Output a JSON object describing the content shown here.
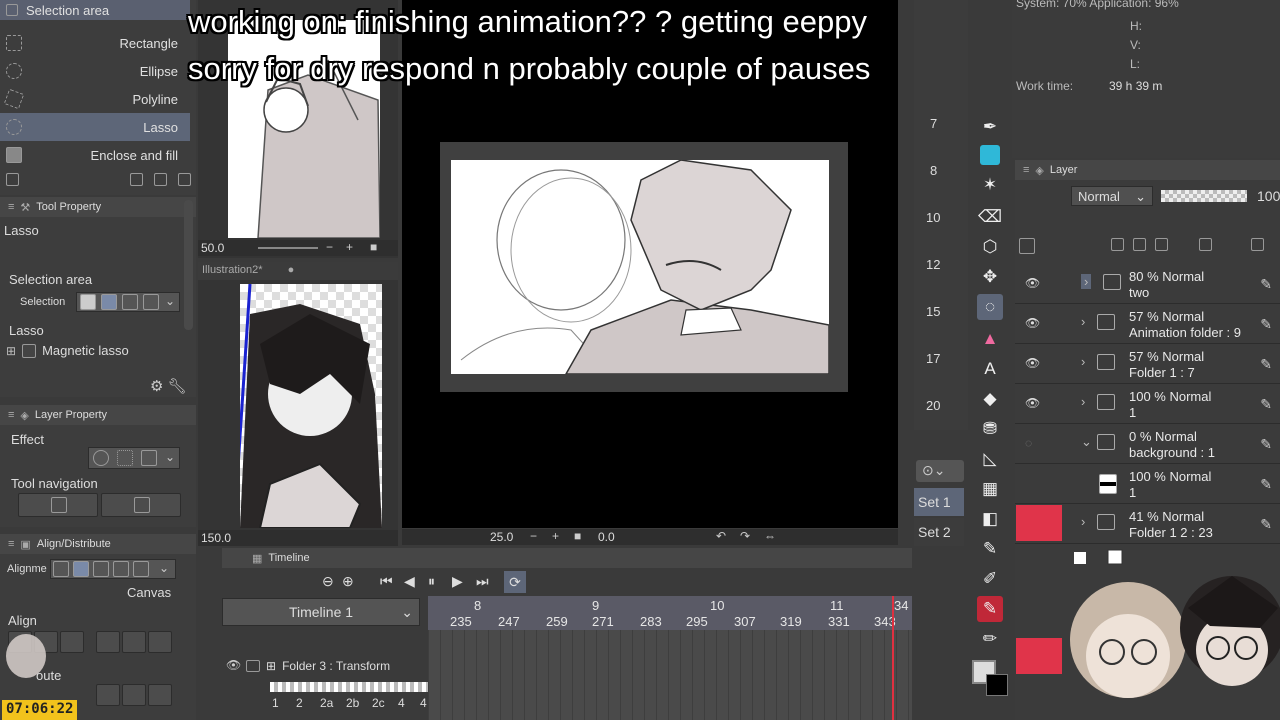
{
  "caption": {
    "line1": "working on: finishing animation?? ? getting eeppy",
    "line2": "sorry for dry respond n probably couple of pauses"
  },
  "tools": {
    "header": "Selection area",
    "items": [
      "Rectangle",
      "Ellipse",
      "Polyline",
      "Lasso",
      "Enclose and fill"
    ],
    "selected": "Lasso"
  },
  "tool_property": {
    "header": "Tool Property",
    "tool_name": "Lasso",
    "selection_area_label": "Selection area",
    "selection_label": "Selection",
    "lasso_label": "Lasso",
    "magnetic_label": "Magnetic lasso"
  },
  "layer_property": {
    "header": "Layer Property",
    "effect_label": "Effect",
    "tool_nav_label": "Tool navigation"
  },
  "align": {
    "header": "Align/Distribute",
    "alignment_label": "Alignme",
    "canvas_label": "Canvas",
    "align_label": "Align",
    "distribute_label": "oute"
  },
  "clock": "07:06:22",
  "preview1": {
    "zoom": "50.0"
  },
  "preview2": {
    "tab": "Illustration2*",
    "zoom": "150.0"
  },
  "canvas_bar": {
    "zoom": "25.0",
    "angle": "0.0"
  },
  "timeline": {
    "header": "Timeline",
    "name": "Timeline 1",
    "folder_label": "Folder 3 : Transform",
    "seconds": [
      "8",
      "9",
      "10",
      "11",
      "34"
    ],
    "frames": [
      "235",
      "247",
      "259",
      "271",
      "283",
      "295",
      "307",
      "319",
      "331",
      "343"
    ],
    "cels": [
      "1",
      "2",
      "2a",
      "2b",
      "2c",
      "4",
      "4"
    ]
  },
  "sets": {
    "set1": "Set 1",
    "set2": "Set 2"
  },
  "ruler": [
    "7",
    "8",
    "10",
    "12",
    "15",
    "17",
    "20"
  ],
  "info": {
    "system": "System: 70% Application: 96%",
    "h": "H:",
    "v": "V:",
    "l": "L:",
    "work_label": "Work time:",
    "work_value": "39 h 39 m"
  },
  "layer_panel": {
    "header": "Layer",
    "blend": "Normal",
    "opacity": "100",
    "layers": [
      {
        "line1": "80 % Normal",
        "line2": "two"
      },
      {
        "line1": "57 % Normal",
        "line2": "Animation folder : 9"
      },
      {
        "line1": "57 % Normal",
        "line2": "Folder 1 : 7"
      },
      {
        "line1": "100 % Normal",
        "line2": "1"
      },
      {
        "line1": "0 % Normal",
        "line2": "background : 1"
      },
      {
        "line1": "100 % Normal",
        "line2": "1"
      },
      {
        "line1": "41 % Normal",
        "line2": "Folder 1 2 : 23"
      }
    ]
  },
  "colors": {
    "accent": "#5d6678",
    "red": "#e0344a",
    "playhead": "#e03040",
    "blue_line": "#1a22d0"
  }
}
